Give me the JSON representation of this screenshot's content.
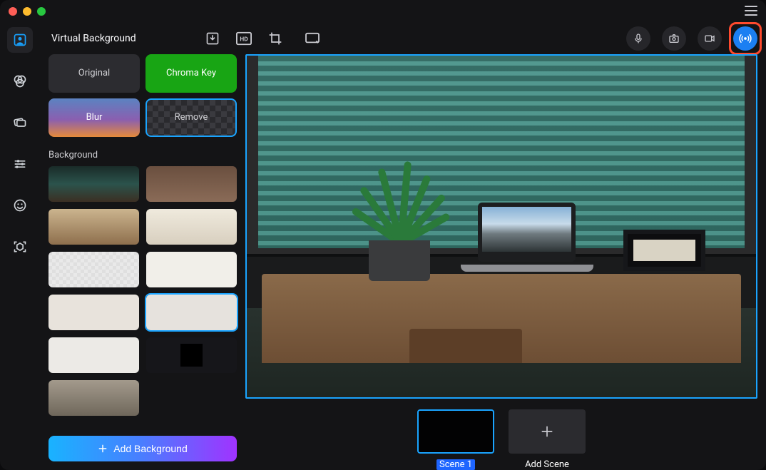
{
  "header": {
    "title": "Virtual Background"
  },
  "sidebar_items": [
    {
      "name": "portrait-icon",
      "active": true
    },
    {
      "name": "color-icon"
    },
    {
      "name": "card-icon"
    },
    {
      "name": "sliders-icon"
    },
    {
      "name": "face-icon"
    },
    {
      "name": "cube-scan-icon"
    }
  ],
  "toolbar_icons": [
    {
      "name": "import-icon"
    },
    {
      "name": "hd-icon"
    },
    {
      "name": "crop-icon"
    },
    {
      "name": "canvas-icon"
    }
  ],
  "right_icons": [
    {
      "name": "mic-icon"
    },
    {
      "name": "camera-icon"
    },
    {
      "name": "video-icon"
    },
    {
      "name": "stream-icon",
      "highlighted": true
    }
  ],
  "modes": {
    "original": "Original",
    "chroma": "Chroma Key",
    "blur": "Blur",
    "remove": "Remove"
  },
  "background_section_title": "Background",
  "backgrounds": [
    {
      "id": 1
    },
    {
      "id": 2
    },
    {
      "id": 3
    },
    {
      "id": 4
    },
    {
      "id": 5
    },
    {
      "id": 6
    },
    {
      "id": 7
    },
    {
      "id": 8,
      "selected": true
    },
    {
      "id": 9
    },
    {
      "id": 10
    },
    {
      "id": 11
    }
  ],
  "add_background_button": "Add Background",
  "scenes": {
    "scene1_label": "Scene 1",
    "add_scene_label": "Add Scene"
  },
  "colors": {
    "accent": "#1aa4ff",
    "highlight": "#ff4a2e"
  }
}
